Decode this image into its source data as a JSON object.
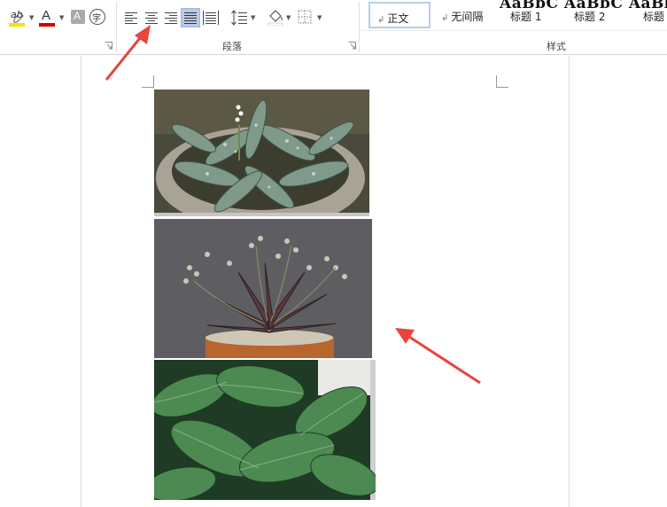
{
  "ribbon": {
    "paragraph_group_label": "段落",
    "styles_group_label": "样式",
    "style_preview_text": "AaBbC AaBbC AaBb",
    "styles": [
      {
        "pilcrow": "↲",
        "label": "正文",
        "selected": true
      },
      {
        "pilcrow": "↲",
        "label": "无间隔",
        "selected": false
      },
      {
        "pilcrow": "",
        "label": "标题 1",
        "selected": false
      },
      {
        "pilcrow": "",
        "label": "标题 2",
        "selected": false
      },
      {
        "pilcrow": "",
        "label": "标题",
        "selected": false
      }
    ],
    "font_tools": {
      "highlight_icon_text": "ab",
      "font_color_icon_text": "A",
      "char_shading_icon_text": "A",
      "enclose_char_icon_text": "字"
    },
    "colors": {
      "highlight": "#f5e600",
      "font_color": "#d40000",
      "justify_selected_bg": "#b9cbe6",
      "annotation_arrow": "#e8453c"
    }
  },
  "document": {
    "images": [
      {
        "subject": "spotted-leaf plant in stone pot"
      },
      {
        "subject": "purple-spotted succulent in terracotta pot"
      },
      {
        "subject": "broad green leaves"
      }
    ]
  }
}
